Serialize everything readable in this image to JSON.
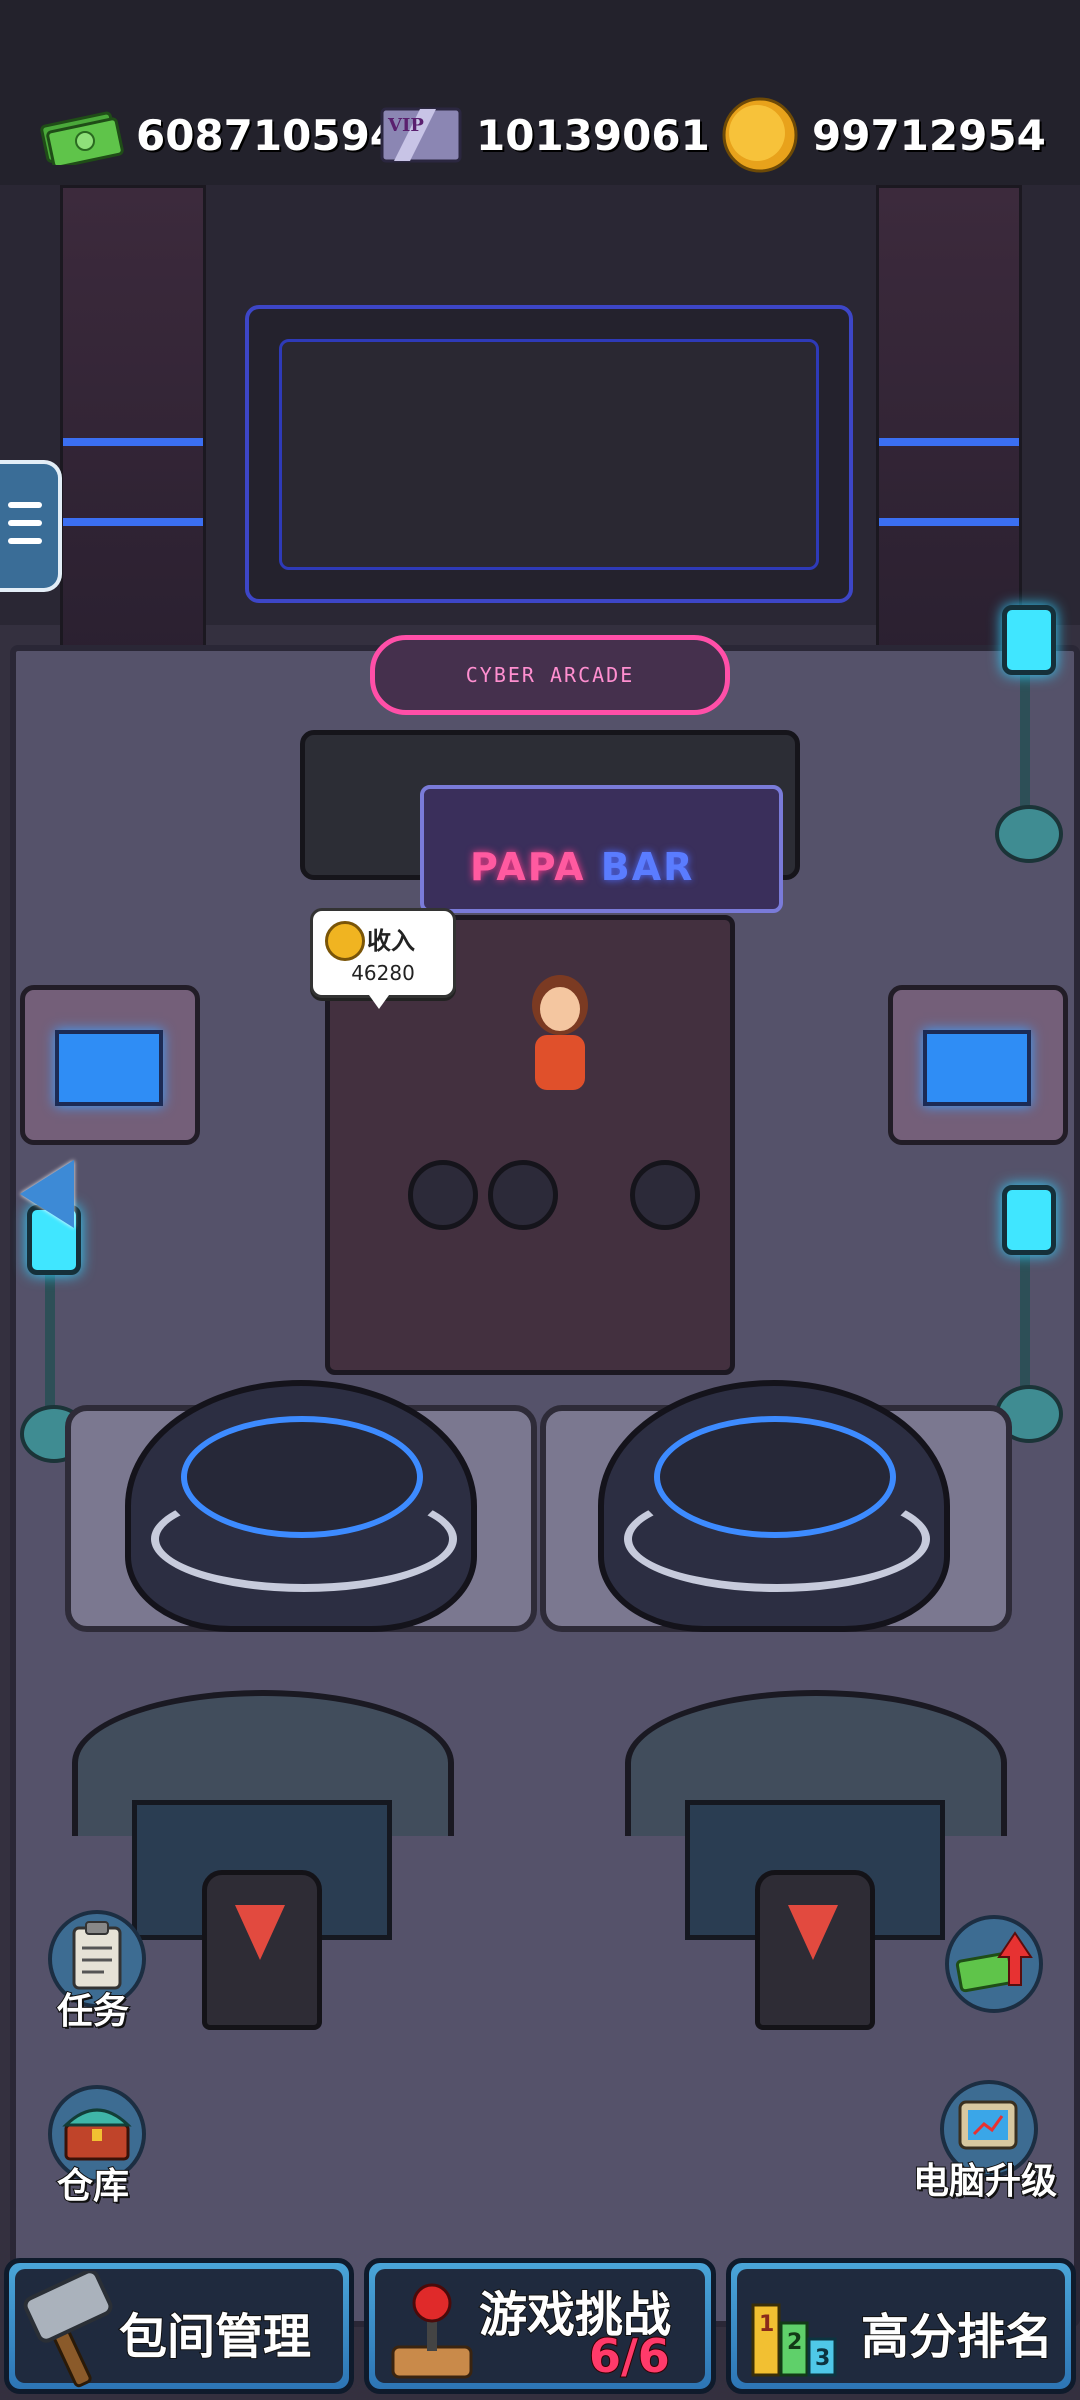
{
  "currencies": {
    "cash": {
      "icon": "cash-icon",
      "value": "608710594"
    },
    "vip": {
      "icon": "vip-card-icon",
      "icon_text": "VIP",
      "value": "10139061"
    },
    "coins": {
      "icon": "gold-coin-icon",
      "value": "99712954"
    }
  },
  "scene": {
    "arcade_sign": "CYBER ARCADE",
    "bar_sign_a": "PAPA",
    "bar_sign_b": "BAR"
  },
  "income_bubble": {
    "label": "收入",
    "value": "46280"
  },
  "side_buttons": {
    "tasks": {
      "icon": "clipboard-icon",
      "label": "任务"
    },
    "warehouse": {
      "icon": "chest-icon",
      "label": "仓库"
    },
    "cash_boost": {
      "icon": "cash-up-arrow-icon"
    },
    "pc_upgrade": {
      "icon": "computer-upgrade-icon",
      "label": "电脑升级"
    }
  },
  "bottom_bar": {
    "room_management": {
      "icon": "hammer-icon",
      "label": "包间管理"
    },
    "game_challenge": {
      "icon": "joystick-icon",
      "label": "游戏挑战",
      "progress": "6/6"
    },
    "leaderboard": {
      "icon": "podium-icon",
      "label": "高分排名",
      "icon_text": [
        "1",
        "2",
        "3"
      ]
    }
  },
  "colors": {
    "neon_pink": "#ff4fa8",
    "neon_blue": "#3d8bff",
    "topbar": "#23222c"
  }
}
